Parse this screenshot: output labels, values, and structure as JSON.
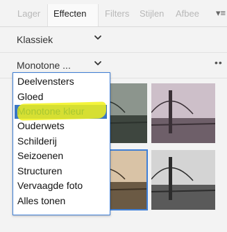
{
  "tabs": [
    {
      "label": "Lager"
    },
    {
      "label": "Effecten"
    },
    {
      "label": "Filters"
    },
    {
      "label": "Stijlen"
    },
    {
      "label": "Afbee"
    }
  ],
  "active_tab_index": 1,
  "tab_menu_icon": "panel-menu-icon",
  "category_select": {
    "value": "Klassiek"
  },
  "effect_select": {
    "value": "Monotone ..."
  },
  "more_icon": "more-options-icon",
  "dropdown": {
    "items": [
      {
        "label": "Deelvensters"
      },
      {
        "label": "Gloed"
      },
      {
        "label": "Monotone kleur"
      },
      {
        "label": "Ouderwets"
      },
      {
        "label": "Schilderij"
      },
      {
        "label": "Seizoenen"
      },
      {
        "label": "Structuren"
      },
      {
        "label": "Vervaagde foto"
      },
      {
        "label": "Alles tonen"
      }
    ],
    "highlighted_index": 2
  },
  "colors": {
    "accent": "#3f7fd6",
    "highlight": "#3a76c4",
    "marker": "#f2f21a",
    "selected_text": "#a8c832"
  }
}
